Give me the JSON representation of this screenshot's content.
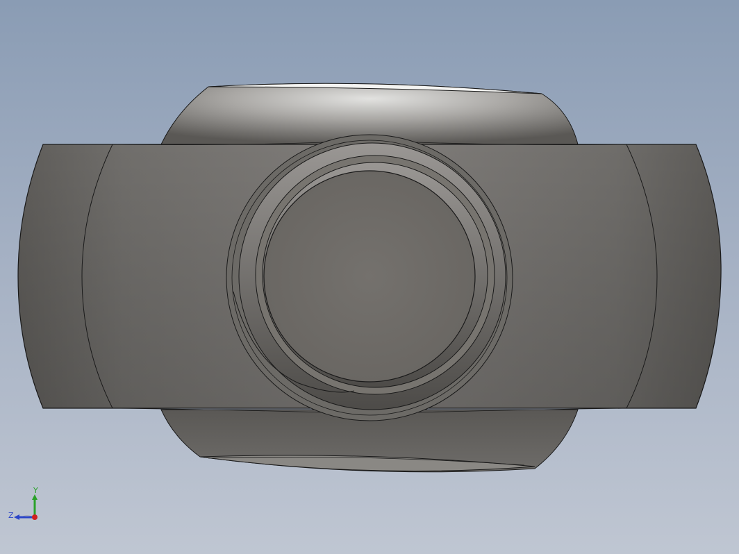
{
  "triad": {
    "y_label": "Y",
    "z_label": "Z",
    "colors": {
      "y_axis": "#2aa12a",
      "z_axis": "#2b45c8",
      "x_axis": "#d02020"
    }
  },
  "colors": {
    "background_top": "#8a9cb4",
    "background_bottom": "#bfc6d2",
    "part_dark": "#5f5d5a",
    "part_mid": "#8a8784",
    "part_light": "#d8d8d6",
    "edge": "#1a1a1a"
  }
}
